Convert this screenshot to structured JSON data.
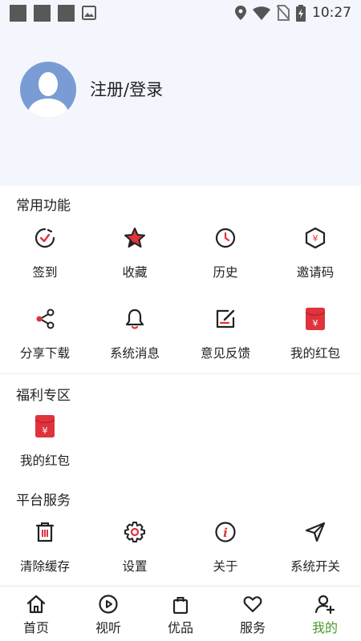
{
  "status_bar": {
    "time": "10:27"
  },
  "profile": {
    "login_label": "注册/登录"
  },
  "colors": {
    "accent_red": "#e0333c",
    "active_green": "#4a9a2a",
    "header_bg": "#f3f6fd"
  },
  "common_functions": {
    "title": "常用功能",
    "items": [
      {
        "label": "签到",
        "icon": "checkin-icon"
      },
      {
        "label": "收藏",
        "icon": "star-icon"
      },
      {
        "label": "历史",
        "icon": "clock-icon"
      },
      {
        "label": "邀请码",
        "icon": "invite-code-icon"
      },
      {
        "label": "分享下载",
        "icon": "share-icon"
      },
      {
        "label": "系统消息",
        "icon": "bell-icon"
      },
      {
        "label": "意见反馈",
        "icon": "feedback-icon"
      },
      {
        "label": "我的红包",
        "icon": "red-packet-icon"
      }
    ]
  },
  "welfare": {
    "title": "福利专区",
    "items": [
      {
        "label": "我的红包",
        "icon": "red-packet-icon"
      }
    ]
  },
  "platform_services": {
    "title": "平台服务",
    "items": [
      {
        "label": "清除缓存",
        "icon": "trash-icon"
      },
      {
        "label": "设置",
        "icon": "gear-icon"
      },
      {
        "label": "关于",
        "icon": "info-icon"
      },
      {
        "label": "系统开关",
        "icon": "send-icon"
      }
    ]
  },
  "bottom_nav": {
    "active": "我的",
    "items": [
      {
        "label": "首页",
        "icon": "home-icon"
      },
      {
        "label": "视听",
        "icon": "play-icon"
      },
      {
        "label": "优品",
        "icon": "shopping-bag-icon"
      },
      {
        "label": "服务",
        "icon": "heart-icon"
      },
      {
        "label": "我的",
        "icon": "user-add-icon"
      }
    ]
  }
}
